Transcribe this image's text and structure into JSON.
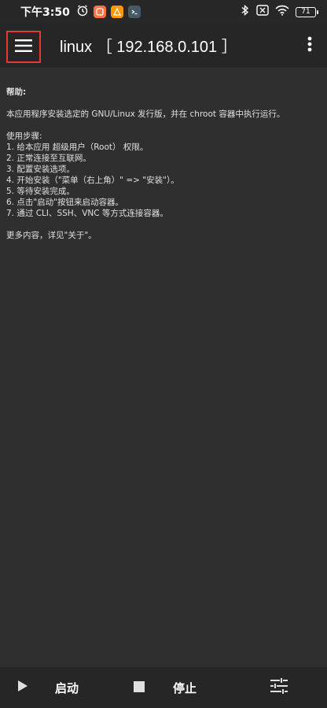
{
  "status_bar": {
    "time": "下午3:50",
    "battery": "71"
  },
  "toolbar": {
    "title": "linux ［ 192.168.0.101 ］"
  },
  "help": {
    "title": "帮助:",
    "intro": "本应用程序安装选定的 GNU/Linux 发行版，并在 chroot 容器中执行运行。",
    "steps_title": "使用步骤:",
    "steps": [
      "1. 给本应用 超级用户（Root） 权限。",
      "2. 正常连接至互联网。",
      "3. 配置安装选项。",
      "4. 开始安装（\"菜单（右上角）\" => \"安装\"）。",
      "5. 等待安装完成。",
      "6. 点击\"启动\"按钮来启动容器。",
      "7. 通过 CLI、SSH、VNC 等方式连接容器。"
    ],
    "more": "更多内容，详见\"关于\"。"
  },
  "bottom_bar": {
    "start_label": "启动",
    "stop_label": "停止"
  }
}
